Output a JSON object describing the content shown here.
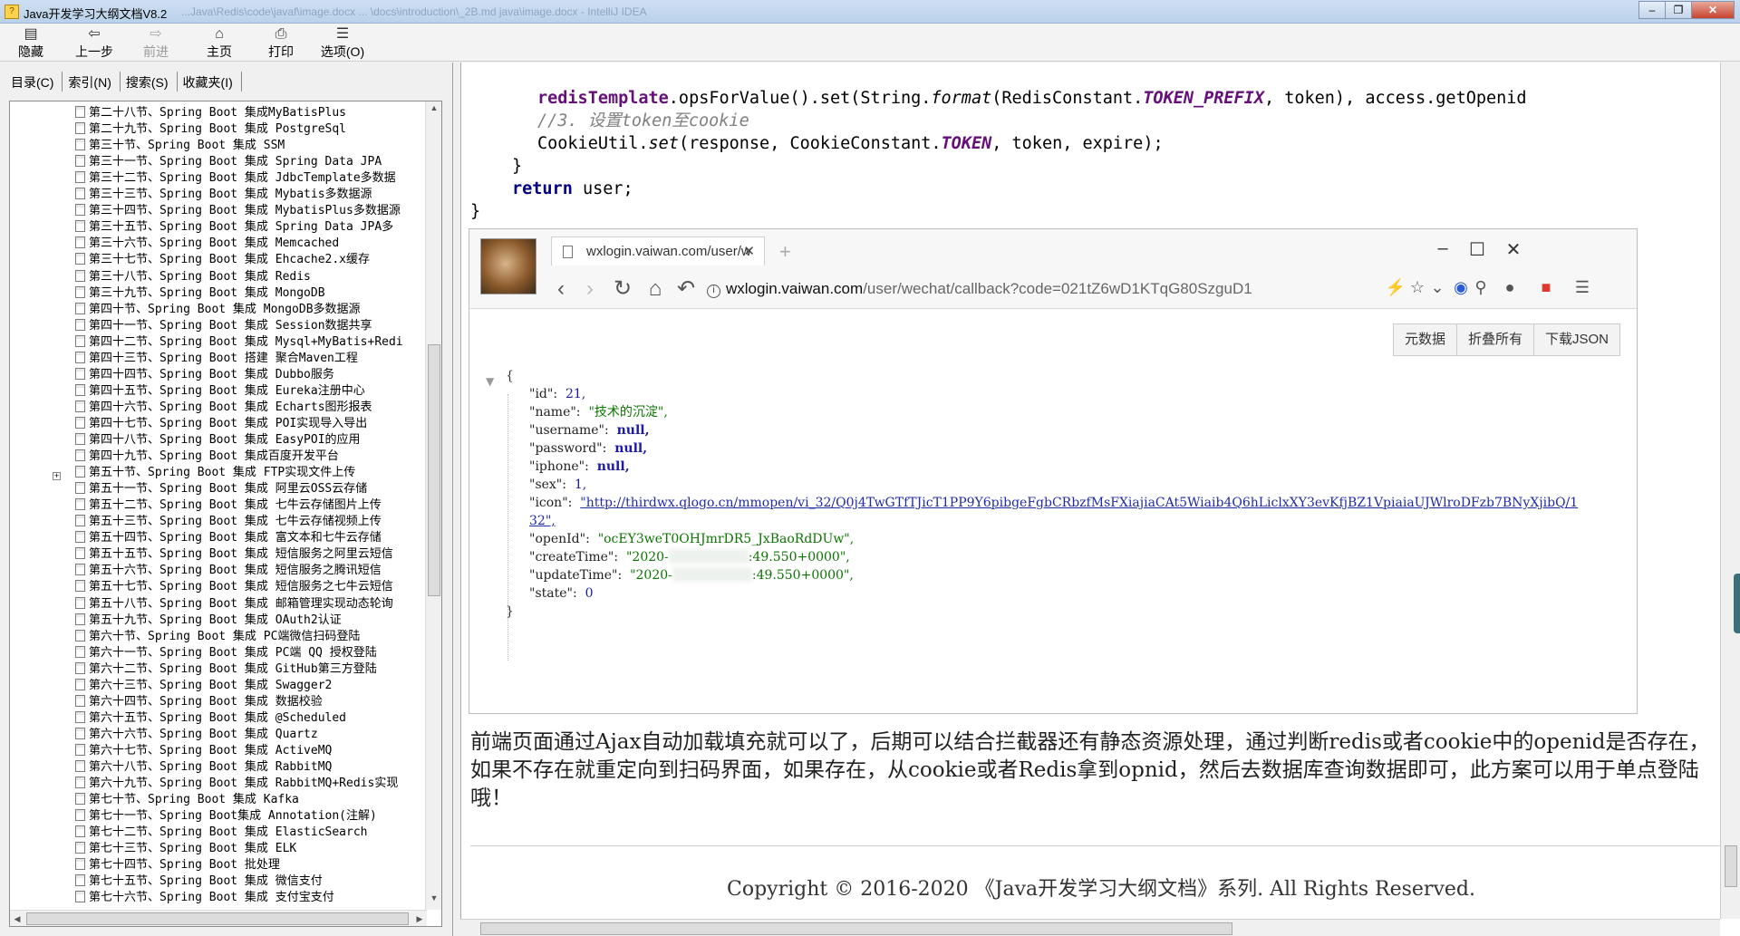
{
  "window": {
    "title": "Java开发学习大纲文档V8.2",
    "faded_title": "...Java\\Redis\\code\\javaf\\image.docx  ...  \\docs\\introduction\\_2B.md  java\\image.docx  - IntelliJ IDEA"
  },
  "toolbar": [
    {
      "label": "隐藏",
      "icon": "hide-icon",
      "enabled": true
    },
    {
      "label": "上一步",
      "icon": "back-arrow-icon",
      "enabled": true
    },
    {
      "label": "前进",
      "icon": "forward-arrow-icon",
      "enabled": false
    },
    {
      "label": "主页",
      "icon": "home-icon",
      "enabled": true
    },
    {
      "label": "打印",
      "icon": "print-icon",
      "enabled": true
    },
    {
      "label": "选项(O)",
      "icon": "options-icon",
      "enabled": true
    }
  ],
  "nav_tabs": [
    "目录(C)",
    "索引(N)",
    "搜索(S)",
    "收藏夹(I)"
  ],
  "tree_items": [
    "第二十八节、Spring Boot 集成MyBatisPlus",
    "第二十九节、Spring Boot 集成 PostgreSql",
    "第三十节、Spring Boot 集成 SSM",
    "第三十一节、Spring Boot 集成 Spring Data JPA",
    "第三十二节、Spring Boot 集成 JdbcTemplate多数据",
    "第三十三节、Spring Boot 集成 Mybatis多数据源",
    "第三十四节、Spring Boot 集成 MybatisPlus多数据源",
    "第三十五节、Spring Boot 集成 Spring Data JPA多",
    "第三十六节、Spring Boot 集成 Memcached",
    "第三十七节、Spring Boot 集成 Ehcache2.x缓存",
    "第三十八节、Spring Boot 集成 Redis",
    "第三十九节、Spring Boot 集成 MongoDB",
    "第四十节、Spring Boot 集成 MongoDB多数据源",
    "第四十一节、Spring Boot 集成 Session数据共享",
    "第四十二节、Spring Boot 集成 Mysql+MyBatis+Redi",
    "第四十三节、Spring Boot 搭建 聚合Maven工程",
    "第四十四节、Spring Boot 集成 Dubbo服务",
    "第四十五节、Spring Boot 集成 Eureka注册中心",
    "第四十六节、Spring Boot 集成 Echarts图形报表",
    "第四十七节、Spring Boot 集成 POI实现导入导出",
    "第四十八节、Spring Boot 集成 EasyPOI的应用",
    "第四十九节、Spring Boot 集成百度开发平台",
    "第五十节、Spring Boot 集成 FTP实现文件上传",
    "第五十一节、Spring Boot 集成 阿里云OSS云存储",
    "第五十二节、Spring Boot 集成 七牛云存储图片上传",
    "第五十三节、Spring Boot 集成 七牛云存储视频上传",
    "第五十四节、Spring Boot 集成 富文本和七牛云存储",
    "第五十五节、Spring Boot 集成 短信服务之阿里云短信",
    "第五十六节、Spring Boot 集成 短信服务之腾讯短信",
    "第五十七节、Spring Boot 集成 短信服务之七牛云短信",
    "第五十八节、Spring Boot 集成 邮箱管理实现动态轮询",
    "第五十九节、Spring Boot 集成 OAuth2认证",
    "第六十节、Spring Boot 集成 PC端微信扫码登陆",
    "第六十一节、Spring Boot 集成 PC端 QQ 授权登陆",
    "第六十二节、Spring Boot 集成 GitHub第三方登陆",
    "第六十三节、Spring Boot 集成 Swagger2",
    "第六十四节、Spring Boot 集成 数据校验",
    "第六十五节、Spring Boot 集成 @Scheduled",
    "第六十六节、Spring Boot 集成 Quartz",
    "第六十七节、Spring Boot 集成 ActiveMQ",
    "第六十八节、Spring Boot 集成 RabbitMQ",
    "第六十九节、Spring Boot 集成 RabbitMQ+Redis实现",
    "第七十节、Spring Boot 集成 Kafka",
    "第七十一节、Spring Boot集成 Annotation(注解)",
    "第七十二节、Spring Boot 集成 ElasticSearch",
    "第七十三节、Spring Boot 集成 ELK",
    "第七十四节、Spring Boot 批处理",
    "第七十五节、Spring Boot 集成 微信支付",
    "第七十六节、Spring Boot 集成 支付宝支付"
  ],
  "code": {
    "line1_obj": "redisTemplate",
    "line1_a": ".opsForValue().set(String.",
    "line1_fmt": "format",
    "line1_b": "(RedisConstant.",
    "line1_const": "TOKEN_PREFIX",
    "line1_c": ", token), access.getOpenid",
    "line2_comment": "//3. 设置token至cookie",
    "line3_a": "CookieUtil.",
    "line3_set": "set",
    "line3_b": "(response, CookieConstant.",
    "line3_const": "TOKEN",
    "line3_c": ", token, expire);",
    "brace1": "}",
    "ret_kw": "return",
    "ret_val": " user;",
    "brace2": "}"
  },
  "browser": {
    "tab_title": "wxlogin.vaiwan.com/user/w",
    "url_host": "wxlogin.vaiwan.com",
    "url_rest": "/user/wechat/callback?code=021tZ6wD1KTqG80SzguD1",
    "json_buttons": [
      "元数据",
      "折叠所有",
      "下载JSON"
    ],
    "json": {
      "open": "{",
      "close": "}",
      "id_k": "\"id\":",
      "id_v": "21,",
      "name_k": "\"name\":",
      "name_v": "\"技术的沉淀\",",
      "username_k": "\"username\":",
      "username_v": "null,",
      "password_k": "\"password\":",
      "password_v": "null,",
      "iphone_k": "\"iphone\":",
      "iphone_v": "null,",
      "sex_k": "\"sex\":",
      "sex_v": "1,",
      "icon_k": "\"icon\":",
      "icon_v1": "\"http://thirdwx.qlogo.cn/mmopen/vi_32/Q0j4TwGTfTJicT1PP9Y6pibgeFgbCRbzfMsFXiajiaCAt5Wiaib4Q6hLiclxXY3evKfjBZ1VpiaiaUJWlroDFzb7BNyXjibQ/1",
      "icon_v2": "32\",",
      "openid_k": "\"openId\":",
      "openid_v": "\"ocEY3weT0OHJmrDR5_JxBaoRdDUw\",",
      "create_k": "\"createTime\":",
      "create_a": "\"2020-",
      "create_b": ":49.550+0000\",",
      "update_k": "\"updateTime\":",
      "update_a": "\"2020-",
      "update_b": ":49.550+0000\",",
      "state_k": "\"state\":",
      "state_v": "0"
    }
  },
  "paragraph": "前端页面通过Ajax自动加载填充就可以了，后期可以结合拦截器还有静态资源处理，通过判断redis或者cookie中的openid是否存在，如果不存在就重定向到扫码界面，如果存在，从cookie或者Redis拿到opnid，然后去数据库查询数据即可，此方案可以用于单点登陆哦！",
  "footer": "Copyright © 2016-2020 《Java开发学习大纲文档》系列. All Rights Reserved."
}
